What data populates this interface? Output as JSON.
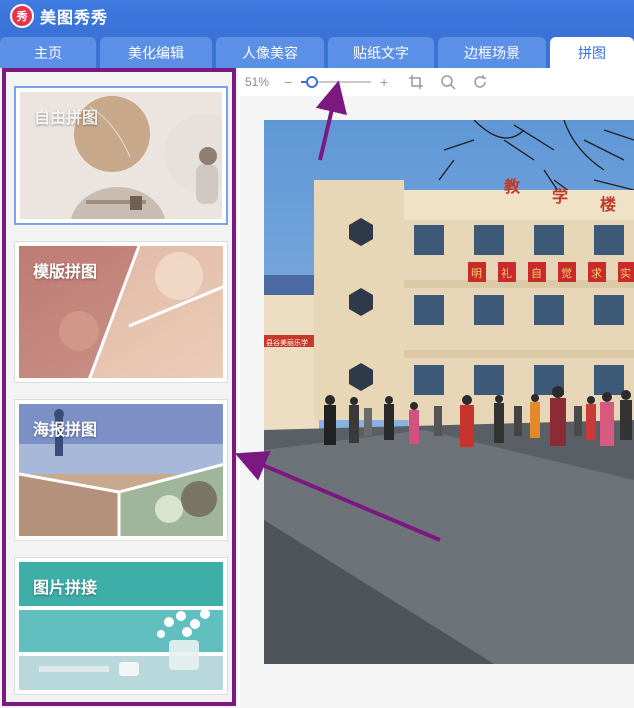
{
  "app": {
    "logo_text": "秀",
    "title": "美图秀秀"
  },
  "nav": {
    "tabs": [
      {
        "label": "主页"
      },
      {
        "label": "美化编辑"
      },
      {
        "label": "人像美容"
      },
      {
        "label": "贴纸文字"
      },
      {
        "label": "边框场景"
      },
      {
        "label": "拼图",
        "active": true
      }
    ]
  },
  "sidebar": {
    "cards": [
      {
        "label": "自由拼图",
        "selected": true
      },
      {
        "label": "模版拼图"
      },
      {
        "label": "海报拼图"
      },
      {
        "label": "图片拼接"
      }
    ]
  },
  "toolbar": {
    "zoom": "51%",
    "zoom_out": "−",
    "zoom_in": "+",
    "zoom_level": 0.15
  },
  "photo": {
    "sign_chars": [
      "教",
      "学",
      "楼"
    ],
    "banner_chars": [
      "明",
      "礼",
      "自",
      "觉",
      "求",
      "实"
    ],
    "plate_text": "县谷美丽乐学"
  },
  "colors": {
    "accent": "#3a72d8",
    "highlight": "#7a1a80"
  }
}
